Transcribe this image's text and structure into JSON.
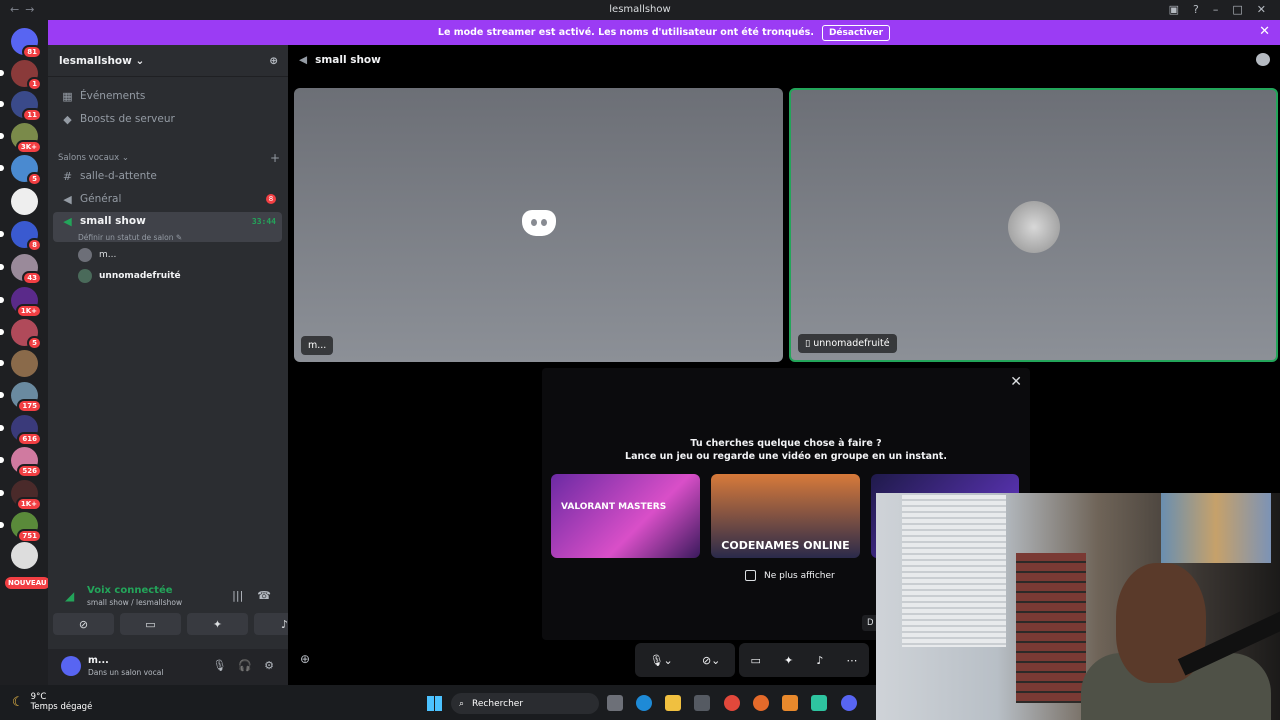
{
  "window": {
    "title": "lesmallshow"
  },
  "banner": {
    "text": "Le mode streamer est activé. Les noms d'utilisateur ont été tronqués.",
    "button": "Désactiver"
  },
  "server_rail": {
    "badges": [
      "81",
      "1",
      "11",
      "3K+",
      "5",
      "",
      "8",
      "43",
      "1K+",
      "5",
      "",
      "175",
      "616",
      "526",
      "1K+",
      "751"
    ],
    "new_label": "NOUVEAU"
  },
  "sidebar": {
    "server_name": "lesmallshow",
    "items": [
      {
        "label": "Événements"
      },
      {
        "label": "Boosts de serveur"
      }
    ],
    "category": "Salons vocaux",
    "channels": [
      {
        "label": "salle-d-attente"
      },
      {
        "label": "Général",
        "badge": "8"
      },
      {
        "label": "small show",
        "timer": "33:44",
        "status": "Définir un statut de salon"
      }
    ],
    "voice_users": [
      "m...",
      "unnomadefruité"
    ],
    "voice_panel": {
      "status": "Voix connectée",
      "location": "small show / lesmallshow"
    },
    "user": {
      "name": "m...",
      "status": "Dans un salon vocal"
    }
  },
  "main": {
    "channel_title": "small show",
    "tiles": [
      {
        "label": "m..."
      },
      {
        "label": "unnomadefruité"
      }
    ],
    "activity": {
      "line1": "Tu cherches quelque chose à faire ?",
      "line2": "Lance un jeu ou regarde une vidéo en groupe en un instant.",
      "cards": [
        "VALORANT MASTERS",
        "CODENAMES ONLINE",
        ""
      ],
      "checkbox": "Ne plus afficher"
    },
    "side_tag": "D"
  },
  "taskbar": {
    "temp": "9°C",
    "weather": "Temps dégagé",
    "search": "Rechercher"
  }
}
